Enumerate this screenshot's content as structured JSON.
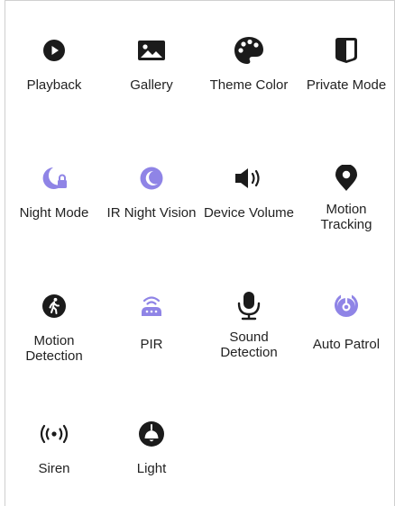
{
  "colors": {
    "icon_dark": "#1b1b1b",
    "icon_accent": "#8f84e6",
    "text": "#222222"
  },
  "tiles": [
    {
      "label": "Playback",
      "icon": "play-circle-icon"
    },
    {
      "label": "Gallery",
      "icon": "image-icon"
    },
    {
      "label": "Theme Color",
      "icon": "palette-icon"
    },
    {
      "label": "Private Mode",
      "icon": "shield-half-icon"
    },
    {
      "label": "Night Mode",
      "icon": "moon-lock-icon"
    },
    {
      "label": "IR Night Vision",
      "icon": "moon-icon"
    },
    {
      "label": "Device Volume",
      "icon": "speaker-icon"
    },
    {
      "label": "Motion Tracking",
      "icon": "location-pin-icon"
    },
    {
      "label": "Motion Detection",
      "icon": "walking-person-icon"
    },
    {
      "label": "PIR",
      "icon": "pir-sensor-icon"
    },
    {
      "label": "Sound Detection",
      "icon": "microphone-icon"
    },
    {
      "label": "Auto Patrol",
      "icon": "patrol-icon"
    },
    {
      "label": "Siren",
      "icon": "siren-icon"
    },
    {
      "label": "Light",
      "icon": "lamp-icon"
    }
  ]
}
